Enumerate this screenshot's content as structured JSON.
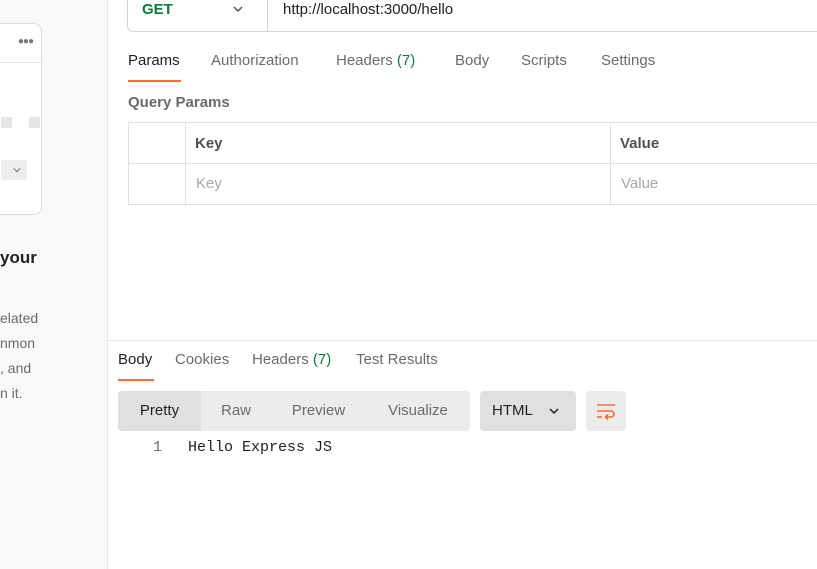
{
  "left_panel": {
    "heading": "your",
    "lines": [
      "elated",
      "nmon",
      ", and",
      "n it."
    ]
  },
  "request": {
    "method": "GET",
    "url": "http://localhost:3000/hello"
  },
  "request_tabs": [
    {
      "label": "Params",
      "active": true
    },
    {
      "label": "Authorization"
    },
    {
      "label": "Headers",
      "count": "(7)"
    },
    {
      "label": "Body"
    },
    {
      "label": "Scripts"
    },
    {
      "label": "Settings"
    }
  ],
  "query_params": {
    "title": "Query Params",
    "headers": {
      "key": "Key",
      "value": "Value"
    },
    "placeholders": {
      "key": "Key",
      "value": "Value"
    }
  },
  "response_tabs": [
    {
      "label": "Body",
      "active": true
    },
    {
      "label": "Cookies"
    },
    {
      "label": "Headers",
      "count": "(7)"
    },
    {
      "label": "Test Results"
    }
  ],
  "view_modes": [
    "Pretty",
    "Raw",
    "Preview",
    "Visualize"
  ],
  "active_view": "Pretty",
  "format": "HTML",
  "response_body": [
    {
      "line": "1",
      "text": "Hello Express JS"
    }
  ],
  "colors": {
    "accent": "#ff6c37",
    "method_get": "#0a7b3e",
    "count": "#0a7b3e"
  },
  "icons": {
    "method_dropdown": "chevron-down-icon",
    "format_dropdown": "chevron-down-icon",
    "wrap": "wrap-lines-icon",
    "more": "more-horizontal-icon"
  }
}
